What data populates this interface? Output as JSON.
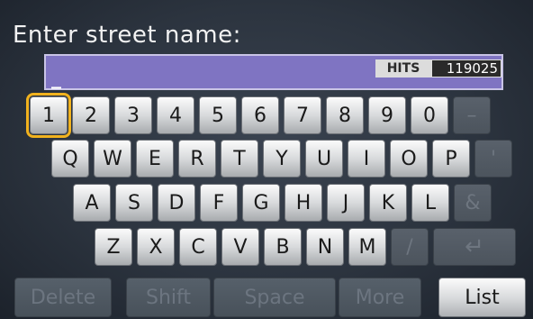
{
  "title": "Enter street name:",
  "entry": {
    "text": "_",
    "hits_label": "HITS",
    "hits_value": "119025"
  },
  "rows": {
    "numbers": [
      "1",
      "2",
      "3",
      "4",
      "5",
      "6",
      "7",
      "8",
      "9",
      "0",
      "–"
    ],
    "qwerty": [
      "Q",
      "W",
      "E",
      "R",
      "T",
      "Y",
      "U",
      "I",
      "O",
      "P",
      "'"
    ],
    "asdf": [
      "A",
      "S",
      "D",
      "F",
      "G",
      "H",
      "J",
      "K",
      "L",
      "&"
    ],
    "zxcv": [
      "Z",
      "X",
      "C",
      "V",
      "B",
      "N",
      "M",
      "/"
    ]
  },
  "enter_icon": "enter-return-icon",
  "enter_glyph": "↵",
  "bottom": {
    "delete": "Delete",
    "shift": "Shift",
    "space": "Space",
    "more": "More",
    "list": "List"
  },
  "colors": {
    "selected_outline": "#f1b21e",
    "entry_bg": "#7f74c2"
  }
}
